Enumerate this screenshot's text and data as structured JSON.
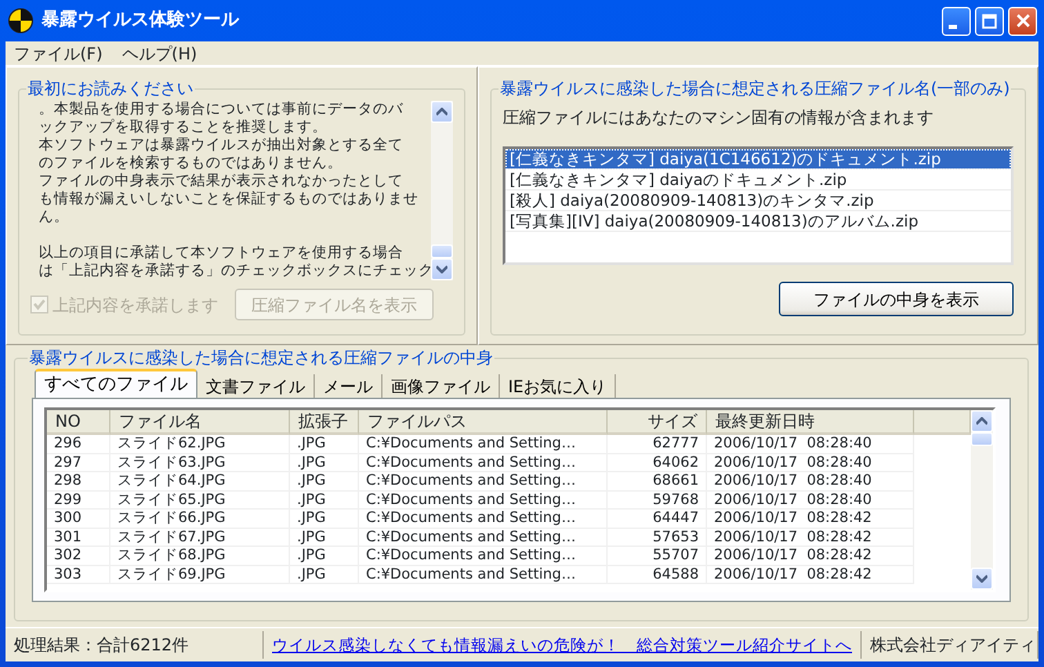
{
  "window": {
    "title": "暴露ウイルス体験ツール"
  },
  "menu": [
    {
      "label": "ファイル(F)"
    },
    {
      "label": "ヘルプ(H)"
    }
  ],
  "notice": {
    "legend": "最初にお読みください",
    "blocks": [
      [
        "。本製品を使用する場合については事前にデータのバ",
        "ックアップを取得することを推奨します。",
        "本ソフトウェアは暴露ウイルスが抽出対象とする全て",
        "のファイルを検索するものではありません。",
        "ファイルの中身表示で結果が表示されなかったとして",
        "も情報が漏えいしないことを保証するものではありませ",
        "ん。"
      ],
      [
        "以上の項目に承諾して本ソフトウェアを使用する場合",
        "は「上記内容を承諾する」のチェックボックスにチェック"
      ]
    ],
    "agree": {
      "label": "上記内容を承諾します",
      "checked": true,
      "disabled": true
    },
    "show_names_button": {
      "label": "圧縮ファイル名を表示",
      "disabled": true
    }
  },
  "archives": {
    "legend": "暴露ウイルスに感染した場合に想定される圧縮ファイル名(一部のみ)",
    "note": "圧縮ファイルにはあなたのマシン固有の情報が含まれます",
    "items": [
      {
        "label": "[仁義なきキンタマ] daiya(1C146612)のドキュメント.zip",
        "selected": true
      },
      {
        "label": "[仁義なきキンタマ] daiyaのドキュメント.zip",
        "selected": false
      },
      {
        "label": "[殺人] daiya(20080909-140813)のキンタマ.zip",
        "selected": false
      },
      {
        "label": "[写真集][IV] daiya(20080909-140813)のアルバム.zip",
        "selected": false
      }
    ],
    "show_content_button": {
      "label": "ファイルの中身を表示"
    }
  },
  "contents": {
    "legend": "暴露ウイルスに感染した場合に想定される圧縮ファイルの中身",
    "tabs": [
      {
        "label": "すべてのファイル",
        "selected": true
      },
      {
        "label": "文書ファイル",
        "selected": false
      },
      {
        "label": "メール",
        "selected": false
      },
      {
        "label": "画像ファイル",
        "selected": false
      },
      {
        "label": "IEお気に入り",
        "selected": false
      }
    ],
    "table": {
      "columns": [
        "NO",
        "ファイル名",
        "拡張子",
        "ファイルパス",
        "サイズ",
        "最終更新日時"
      ],
      "rows": [
        [
          "296",
          "スライド62.JPG",
          ".JPG",
          "C:¥Documents and Setting…",
          "62777",
          "2006/10/17  08:28:40"
        ],
        [
          "297",
          "スライド63.JPG",
          ".JPG",
          "C:¥Documents and Setting…",
          "64062",
          "2006/10/17  08:28:40"
        ],
        [
          "298",
          "スライド64.JPG",
          ".JPG",
          "C:¥Documents and Setting…",
          "68661",
          "2006/10/17  08:28:40"
        ],
        [
          "299",
          "スライド65.JPG",
          ".JPG",
          "C:¥Documents and Setting…",
          "59768",
          "2006/10/17  08:28:40"
        ],
        [
          "300",
          "スライド66.JPG",
          ".JPG",
          "C:¥Documents and Setting…",
          "64447",
          "2006/10/17  08:28:42"
        ],
        [
          "301",
          "スライド67.JPG",
          ".JPG",
          "C:¥Documents and Setting…",
          "57653",
          "2006/10/17  08:28:42"
        ],
        [
          "302",
          "スライド68.JPG",
          ".JPG",
          "C:¥Documents and Setting…",
          "55707",
          "2006/10/17  08:28:42"
        ],
        [
          "303",
          "スライド69.JPG",
          ".JPG",
          "C:¥Documents and Setting…",
          "64588",
          "2006/10/17  08:28:42"
        ]
      ]
    }
  },
  "status_bar": {
    "result": "処理結果：合計6212件",
    "link": "ウイルス感染しなくても情報漏えいの危険が！　総合対策ツール紹介サイトへ",
    "company": "株式会社ディアイティ"
  }
}
